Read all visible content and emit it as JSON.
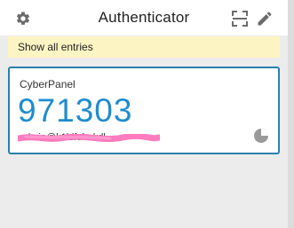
{
  "header": {
    "title": "Authenticator",
    "icons": [
      "gear-icon",
      "scan-qr-icon",
      "pencil-icon"
    ]
  },
  "notice": {
    "label": "Show all entries"
  },
  "entry": {
    "issuer": "CyberPanel",
    "code": "971303",
    "account": "admin@k1ldfuhakdl",
    "timer_icon": "countdown-timer-icon",
    "timer_fraction_elapsed": 0.75
  },
  "colors": {
    "code": "#1f8ccf",
    "card_border": "#2a7fad",
    "notice_bg": "#fdf4c4",
    "redaction": "#ff7bbf"
  }
}
